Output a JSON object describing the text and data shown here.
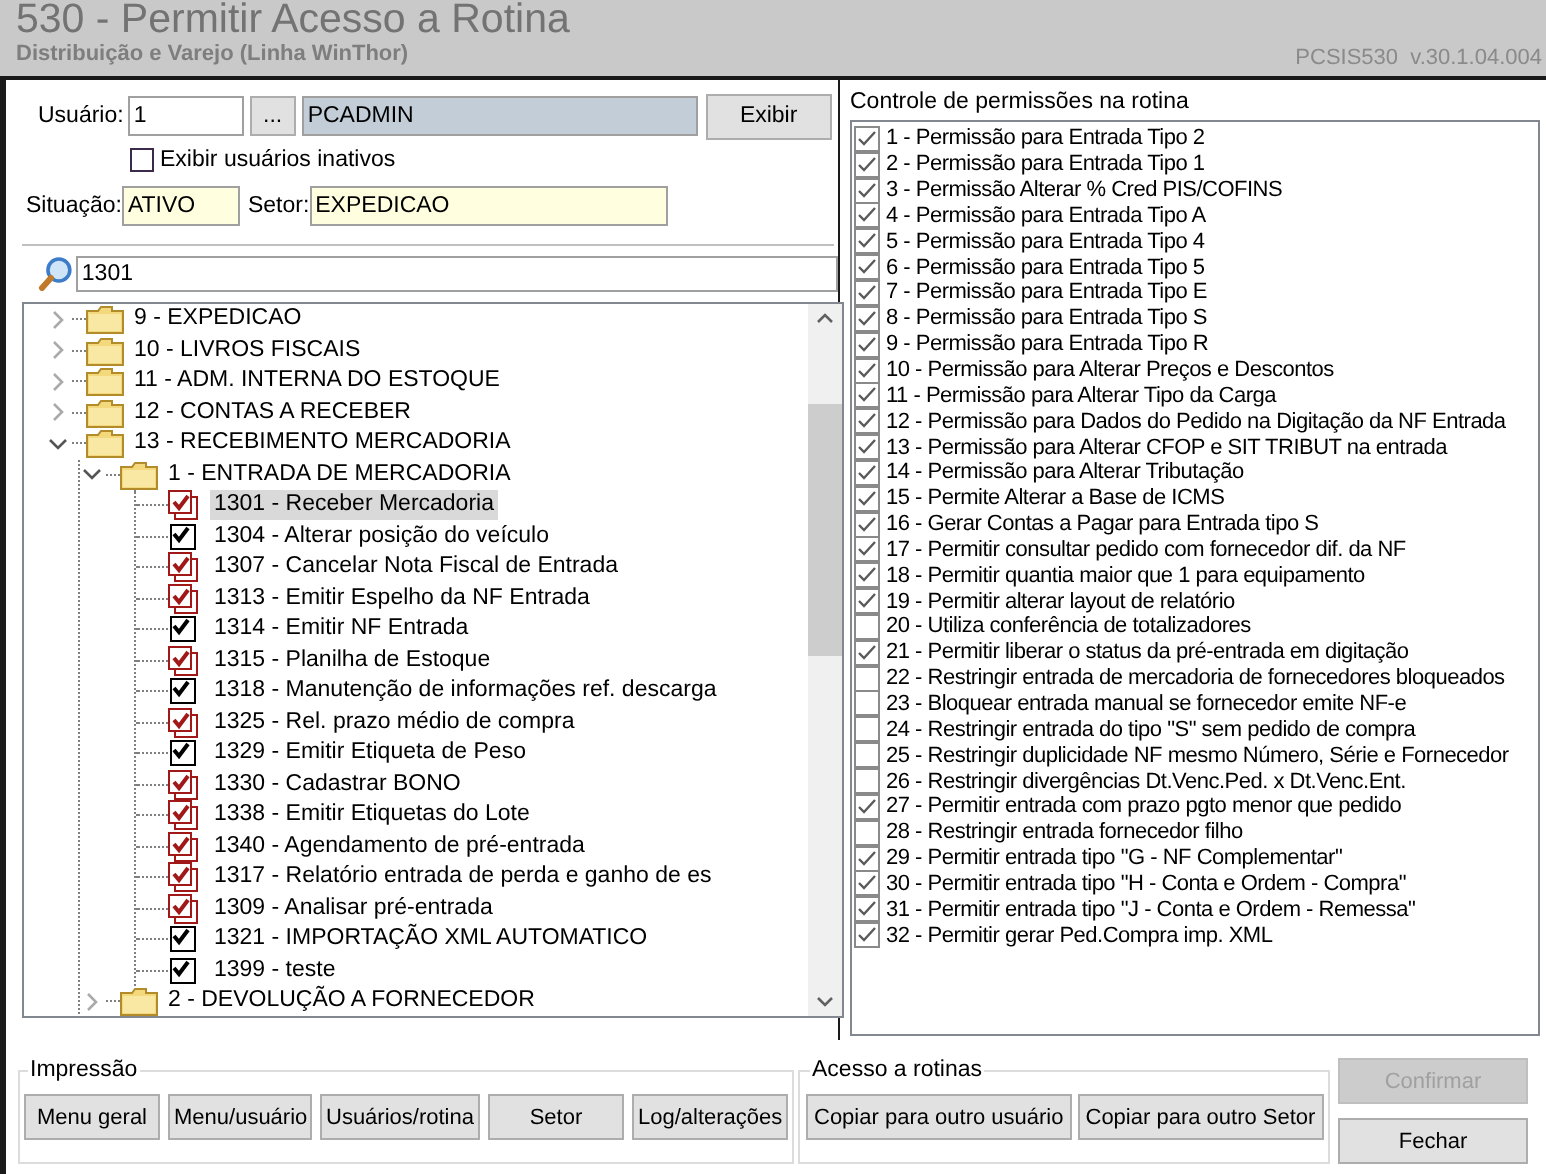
{
  "window": {
    "title": "530 - Permitir Acesso a Rotina",
    "subtitle": "Distribuição e Varejo (Linha WinThor)",
    "version": "PCSIS530  v.30.1.04.004"
  },
  "user": {
    "label": "Usuário:",
    "code": "1",
    "lookup_button": "...",
    "name": "PCADMIN",
    "show_button": "Exibir",
    "inactive_checkbox": {
      "label": "Exibir usuários inativos",
      "checked": false
    },
    "status_label": "Situação:",
    "status": "ATIVO",
    "sector_label": "Setor:",
    "sector": "EXPEDICAO"
  },
  "search": {
    "value": "1301"
  },
  "tree": [
    {
      "label": "9 - EXPEDICAO",
      "kind": "folder",
      "expanded": false
    },
    {
      "label": "10 - LIVROS FISCAIS",
      "kind": "folder",
      "expanded": false
    },
    {
      "label": "11 - ADM. INTERNA DO ESTOQUE",
      "kind": "folder",
      "expanded": false
    },
    {
      "label": "12 - CONTAS A RECEBER",
      "kind": "folder",
      "expanded": false
    },
    {
      "label": "13 - RECEBIMENTO MERCADORIA",
      "kind": "folder",
      "expanded": true,
      "children": [
        {
          "label": "1 - ENTRADA DE MERCADORIA",
          "kind": "folder",
          "expanded": true,
          "children": [
            {
              "label": "1301 - Receber Mercadoria",
              "kind": "routine",
              "checked": true,
              "highlighted": true,
              "selected": true
            },
            {
              "label": "1304 - Alterar posição do veículo",
              "kind": "routine",
              "checked": true,
              "highlighted": false,
              "selected": false
            },
            {
              "label": "1307 - Cancelar Nota Fiscal de  Entrada",
              "kind": "routine",
              "checked": true,
              "highlighted": true,
              "selected": false
            },
            {
              "label": "1313 - Emitir Espelho da NF Entrada",
              "kind": "routine",
              "checked": true,
              "highlighted": true,
              "selected": false
            },
            {
              "label": "1314 - Emitir NF Entrada",
              "kind": "routine",
              "checked": true,
              "highlighted": false,
              "selected": false
            },
            {
              "label": "1315 - Planilha de Estoque",
              "kind": "routine",
              "checked": true,
              "highlighted": true,
              "selected": false
            },
            {
              "label": "1318 - Manutenção de informações ref. descarga",
              "kind": "routine",
              "checked": true,
              "highlighted": false,
              "selected": false
            },
            {
              "label": "1325 - Rel. prazo médio de compra",
              "kind": "routine",
              "checked": true,
              "highlighted": true,
              "selected": false
            },
            {
              "label": "1329 - Emitir Etiqueta de Peso",
              "kind": "routine",
              "checked": true,
              "highlighted": false,
              "selected": false
            },
            {
              "label": "1330 - Cadastrar BONO",
              "kind": "routine",
              "checked": true,
              "highlighted": true,
              "selected": false
            },
            {
              "label": "1338 - Emitir Etiquetas do Lote",
              "kind": "routine",
              "checked": true,
              "highlighted": true,
              "selected": false
            },
            {
              "label": "1340 - Agendamento de pré-entrada",
              "kind": "routine",
              "checked": true,
              "highlighted": true,
              "selected": false
            },
            {
              "label": "1317 - Relatório entrada de perda e ganho de es",
              "kind": "routine",
              "checked": true,
              "highlighted": true,
              "selected": false
            },
            {
              "label": "1309 - Analisar pré-entrada",
              "kind": "routine",
              "checked": true,
              "highlighted": true,
              "selected": false
            },
            {
              "label": "1321 - IMPORTAÇÃO XML AUTOMATICO",
              "kind": "routine",
              "checked": true,
              "highlighted": false,
              "selected": false
            },
            {
              "label": "1399 - teste",
              "kind": "routine",
              "checked": true,
              "highlighted": false,
              "selected": false
            }
          ]
        },
        {
          "label": "2 - DEVOLUÇÃO A FORNECEDOR",
          "kind": "folder",
          "expanded": false
        }
      ]
    }
  ],
  "permissions": {
    "title": "Controle de permissões na rotina",
    "items": [
      {
        "label": "1 - Permissão para Entrada Tipo 2",
        "checked": true
      },
      {
        "label": "2 - Permissão para Entrada Tipo 1",
        "checked": true
      },
      {
        "label": "3 - Permissão Alterar % Cred PIS/COFINS",
        "checked": true
      },
      {
        "label": "4 - Permissão para Entrada Tipo A",
        "checked": true
      },
      {
        "label": "5 - Permissão para Entrada Tipo 4",
        "checked": true
      },
      {
        "label": "6 - Permissão para Entrada Tipo 5",
        "checked": true
      },
      {
        "label": "7 - Permissão para Entrada Tipo E",
        "checked": true
      },
      {
        "label": "8 - Permissão para Entrada Tipo S",
        "checked": true
      },
      {
        "label": "9 - Permissão para Entrada Tipo R",
        "checked": true
      },
      {
        "label": "10 - Permissão para Alterar Preços e Descontos",
        "checked": true
      },
      {
        "label": "11 - Permissão para Alterar Tipo da Carga",
        "checked": true
      },
      {
        "label": "12 - Permissão para Dados do Pedido na Digitação da NF Entrada",
        "checked": true
      },
      {
        "label": "13 - Permissão para Alterar CFOP e SIT TRIBUT na entrada",
        "checked": true
      },
      {
        "label": "14 - Permissão para Alterar Tributação",
        "checked": true
      },
      {
        "label": "15 - Permite Alterar a Base de ICMS",
        "checked": true
      },
      {
        "label": "16 - Gerar Contas a Pagar para Entrada tipo S",
        "checked": true
      },
      {
        "label": "17 - Permitir consultar pedido com fornecedor dif. da NF",
        "checked": true
      },
      {
        "label": "18 - Permitir quantia maior que 1 para equipamento",
        "checked": true
      },
      {
        "label": "19 - Permitir alterar layout de relatório",
        "checked": true
      },
      {
        "label": "20 - Utiliza conferência de totalizadores",
        "checked": false
      },
      {
        "label": "21 - Permitir liberar o status da pré-entrada em digitação",
        "checked": true
      },
      {
        "label": "22 - Restringir entrada de mercadoria de fornecedores bloqueados",
        "checked": false
      },
      {
        "label": "23 - Bloquear entrada manual se fornecedor emite NF-e",
        "checked": false
      },
      {
        "label": "24 - Restringir entrada do tipo \"S\" sem pedido de compra",
        "checked": false
      },
      {
        "label": "25 - Restringir duplicidade NF mesmo Número, Série e Fornecedor",
        "checked": false
      },
      {
        "label": "26 - Restringir divergências Dt.Venc.Ped. x Dt.Venc.Ent.",
        "checked": false
      },
      {
        "label": "27 - Permitir entrada com prazo pgto menor que pedido",
        "checked": true
      },
      {
        "label": "28 - Restringir entrada fornecedor filho",
        "checked": false
      },
      {
        "label": "29 - Permitir entrada tipo \"G - NF Complementar\"",
        "checked": true
      },
      {
        "label": "30 - Permitir entrada tipo \"H - Conta e Ordem - Compra\"",
        "checked": true
      },
      {
        "label": "31 - Permitir entrada tipo \"J - Conta e Ordem - Remessa\"",
        "checked": true
      },
      {
        "label": "32 - Permitir gerar Ped.Compra imp. XML",
        "checked": true
      }
    ]
  },
  "print_group": {
    "title": "Impressão",
    "buttons": [
      "Menu geral",
      "Menu/usuário",
      "Usuários/rotina",
      "Setor",
      "Log/alterações"
    ]
  },
  "access_group": {
    "title": "Acesso a rotinas",
    "buttons": [
      "Copiar para outro usuário",
      "Copiar para outro Setor"
    ]
  },
  "actions": [
    {
      "label": "Confirmar",
      "disabled": true
    },
    {
      "label": "Fechar",
      "disabled": false
    }
  ]
}
